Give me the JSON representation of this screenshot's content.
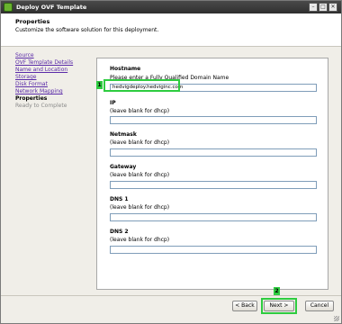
{
  "window": {
    "title": "Deploy OVF Template",
    "minimize": "–",
    "maximize": "□",
    "close": "✕"
  },
  "header": {
    "title": "Properties",
    "subtitle": "Customize the software solution for this deployment."
  },
  "nav": {
    "items": [
      {
        "label": "Source",
        "state": "link"
      },
      {
        "label": "OVF Template Details",
        "state": "link"
      },
      {
        "label": "Name and Location",
        "state": "link"
      },
      {
        "label": "Storage",
        "state": "link"
      },
      {
        "label": "Disk Format",
        "state": "link"
      },
      {
        "label": "Network Mapping",
        "state": "link"
      },
      {
        "label": "Properties",
        "state": "current"
      },
      {
        "label": "Ready to Complete",
        "state": "disabled"
      }
    ]
  },
  "form": {
    "hostname": {
      "label": "Hostname",
      "hint": "Please enter a Fully Qualified Domain Name",
      "value": "hedvigdeploy.hedviginc.com"
    },
    "ip": {
      "label": "IP",
      "hint": "(leave blank for dhcp)",
      "value": ""
    },
    "netmask": {
      "label": "Netmask",
      "hint": "(leave blank for dhcp)",
      "value": ""
    },
    "gateway": {
      "label": "Gateway",
      "hint": "(leave blank for dhcp)",
      "value": ""
    },
    "dns1": {
      "label": "DNS 1",
      "hint": "(leave blank for dhcp)",
      "value": ""
    },
    "dns2": {
      "label": "DNS 2",
      "hint": "(leave blank for dhcp)",
      "value": ""
    }
  },
  "annotations": {
    "step1": "1",
    "step2": "2",
    "color": "#2ecc40"
  },
  "buttons": {
    "back": "< Back",
    "next": "Next >",
    "cancel": "Cancel"
  }
}
